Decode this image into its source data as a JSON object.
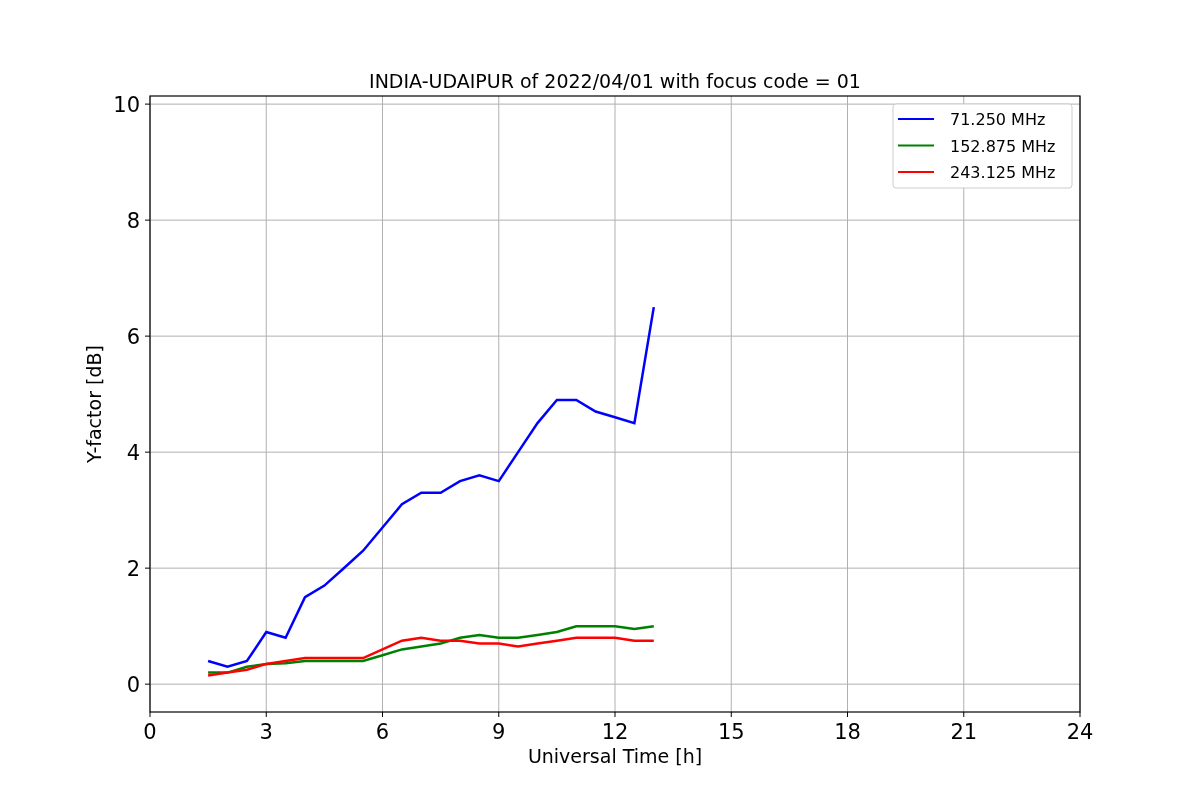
{
  "chart_data": {
    "type": "line",
    "title": "INDIA-UDAIPUR of 2022/04/01 with focus code = 01",
    "xlabel": "Universal Time [h]",
    "ylabel": "Y-factor [dB]",
    "x": [
      1.5,
      2,
      2.5,
      3,
      3.5,
      4,
      4.5,
      5,
      5.5,
      6,
      6.5,
      7,
      7.5,
      8,
      8.5,
      9,
      9.5,
      10,
      10.5,
      11,
      11.5,
      12,
      12.5,
      13
    ],
    "series": [
      {
        "name": "71.250 MHz",
        "color": "#0000ff",
        "values": [
          0.4,
          0.3,
          0.4,
          0.9,
          0.8,
          1.5,
          1.7,
          2.0,
          2.3,
          2.7,
          3.1,
          3.3,
          3.3,
          3.5,
          3.6,
          3.5,
          4.0,
          4.5,
          4.9,
          4.9,
          4.7,
          4.6,
          4.5,
          6.5
        ]
      },
      {
        "name": "152.875 MHz",
        "color": "#008000",
        "values": [
          0.2,
          0.2,
          0.3,
          0.35,
          0.36,
          0.4,
          0.4,
          0.4,
          0.4,
          0.5,
          0.6,
          0.65,
          0.7,
          0.8,
          0.85,
          0.8,
          0.8,
          0.85,
          0.9,
          1.0,
          1.0,
          1.0,
          0.95,
          1.0
        ]
      },
      {
        "name": "243.125 MHz",
        "color": "#ff0000",
        "values": [
          0.15,
          0.2,
          0.25,
          0.35,
          0.4,
          0.45,
          0.45,
          0.45,
          0.45,
          0.6,
          0.75,
          0.8,
          0.75,
          0.75,
          0.7,
          0.7,
          0.65,
          0.7,
          0.75,
          0.8,
          0.8,
          0.8,
          0.75,
          0.75
        ]
      }
    ],
    "grid": true,
    "legend": true,
    "xlim": [
      0,
      24
    ],
    "ylim": [
      -0.48,
      10.14
    ],
    "xticks": [
      0,
      3,
      6,
      9,
      12,
      15,
      18,
      21,
      24
    ],
    "yticks": [
      0,
      2,
      4,
      6,
      8,
      10
    ]
  }
}
